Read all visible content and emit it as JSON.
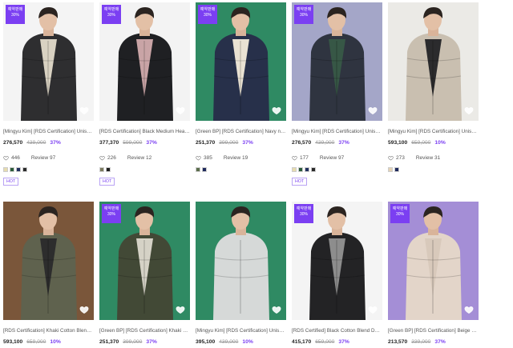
{
  "badge": {
    "line1": "예약판매",
    "line2": "30%"
  },
  "review_label": "Review",
  "hot_label": "HOT",
  "products": [
    {
      "title": "[Mingyu Kim] [RDS Certification] Unisex Tape...",
      "price": "276,570",
      "original": "439,000",
      "discount": "37%",
      "likes": "446",
      "reviews": "97",
      "badge": true,
      "hot": true,
      "bg": "#f4f4f4",
      "jacket": "#2e2e30",
      "inner": "#d9d2c2",
      "pants": "#e0d8c6",
      "swatches": [
        "#e6dcae",
        "#2b5b3a",
        "#21305e",
        "#2a2a2a"
      ]
    },
    {
      "title": "[RDS Certification] Black Medium Heavy Tape...",
      "price": "377,370",
      "original": "599,000",
      "discount": "37%",
      "likes": "226",
      "reviews": "12",
      "badge": true,
      "hot": true,
      "bg": "#f3f3f3",
      "jacket": "#1f2023",
      "inner": "#c9a4a6",
      "pants": "#c9b9a0",
      "swatches": [
        "#7b7a5e",
        "#1e1e1e"
      ]
    },
    {
      "title": "[Green BP] [RDS Certification] Navy non Tape...",
      "price": "251,370",
      "original": "399,000",
      "discount": "37%",
      "likes": "385",
      "reviews": "19",
      "badge": true,
      "hot": false,
      "bg": "#2f8a63",
      "jacket": "#27304a",
      "inner": "#e9e2d3",
      "pants": "#ded4c0",
      "swatches": [
        "#5b6e4c",
        "#1f2a5c"
      ]
    },
    {
      "title": "[Mingyu Kim] [RDS Certification] Unisex Tape...",
      "price": "276,570",
      "original": "439,000",
      "discount": "37%",
      "likes": "177",
      "reviews": "97",
      "badge": true,
      "hot": true,
      "bg": "#a4a6c8",
      "jacket": "#2f3440",
      "inner": "#375746",
      "pants": "#4a6a9b",
      "swatches": [
        "#e6dcae",
        "#2b5b3a",
        "#21305e",
        "#2a2a2a"
      ]
    },
    {
      "title": "[Mingyu Kim] [RDS Certification] Unisex Tape...",
      "price": "593,100",
      "original": "659,000",
      "discount": "10%",
      "likes": "273",
      "reviews": "31",
      "badge": false,
      "hot": false,
      "bg": "#ebeae6",
      "jacket": "#c9bfb0",
      "inner": "#2b2b2d",
      "pants": "#2b2b2d",
      "swatches": [
        "#e4d2b4",
        "#1f2a5c"
      ]
    },
    {
      "title": "[RDS Certification] Khaki Cotton Blend B...",
      "price": "593,100",
      "original": "659,000",
      "discount": "10%",
      "badge": false,
      "bg": "#7a563a",
      "jacket": "#5f624e",
      "inner": "#2d2d2d",
      "pants": "#2d2d2d"
    },
    {
      "title": "[Green BP] [RDS Certification] Khaki non...",
      "price": "251,370",
      "original": "399,000",
      "discount": "37%",
      "badge": true,
      "bg": "#2f8a63",
      "jacket": "#424936",
      "inner": "#d5d2c6",
      "pants": "#2d2d2d"
    },
    {
      "title": "[Mingyu Kim] [RDS Certification] Unisex I...",
      "price": "395,100",
      "original": "439,000",
      "discount": "10%",
      "badge": false,
      "bg": "#2f8a63",
      "jacket": "#d6d9d8",
      "inner": "#d6d9d8",
      "pants": "#2d2d2d"
    },
    {
      "title": "[RDS Certified] Black Cotton Blend Deta...",
      "price": "415,170",
      "original": "659,000",
      "discount": "37%",
      "badge": true,
      "bg": "#f4f4f4",
      "jacket": "#232325",
      "inner": "#8d8d8d",
      "pants": "#232325"
    },
    {
      "title": "[Green BP] [RDS Certification] Beige Sta...",
      "price": "213,570",
      "original": "339,000",
      "discount": "37%",
      "badge": true,
      "bg": "#a48ed6",
      "jacket": "#e3d5c9",
      "inner": "#d8c9bb",
      "pants": "#7a6a58"
    }
  ]
}
